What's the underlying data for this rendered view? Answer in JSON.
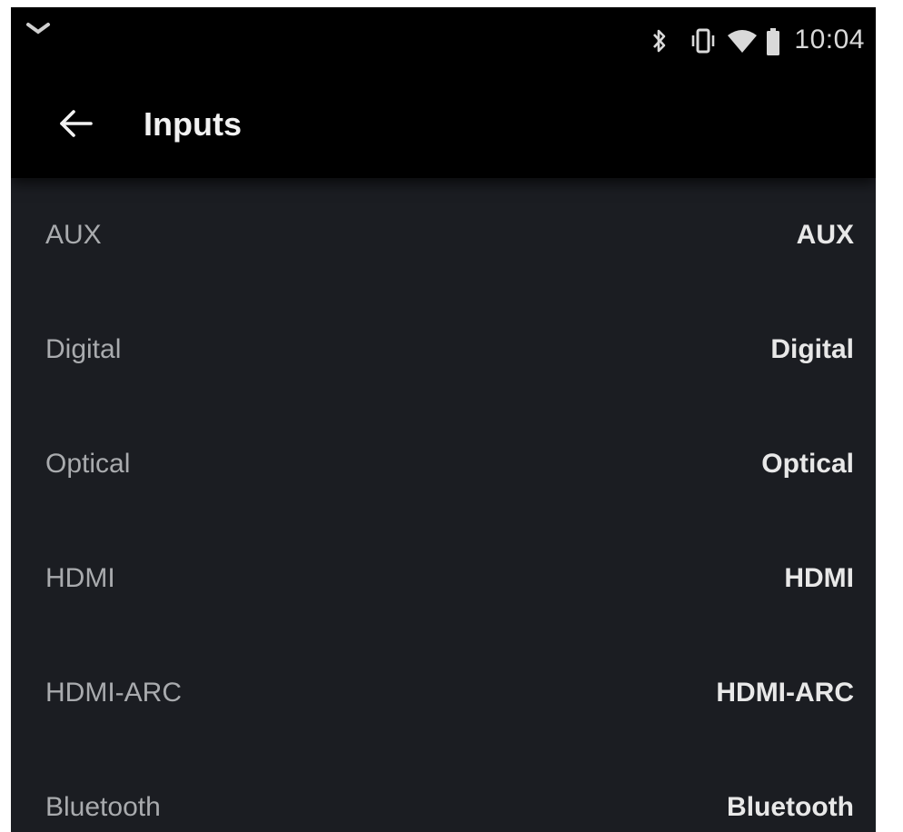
{
  "status_bar": {
    "time": "10:04",
    "left_icon": "notification-chevron-icon",
    "right_icons": [
      "bluetooth-icon",
      "vibrate-icon",
      "wifi-icon",
      "battery-icon"
    ]
  },
  "app_bar": {
    "title": "Inputs",
    "back_icon": "back-arrow-icon"
  },
  "inputs": [
    {
      "label": "AUX",
      "value": "AUX"
    },
    {
      "label": "Digital",
      "value": "Digital"
    },
    {
      "label": "Optical",
      "value": "Optical"
    },
    {
      "label": "HDMI",
      "value": "HDMI"
    },
    {
      "label": "HDMI-ARC",
      "value": "HDMI-ARC"
    },
    {
      "label": "Bluetooth",
      "value": "Bluetooth"
    }
  ],
  "colors": {
    "background": "#1b1d22",
    "bar": "#000000",
    "label_text": "#a9abae",
    "value_text": "#e8e8e8"
  }
}
